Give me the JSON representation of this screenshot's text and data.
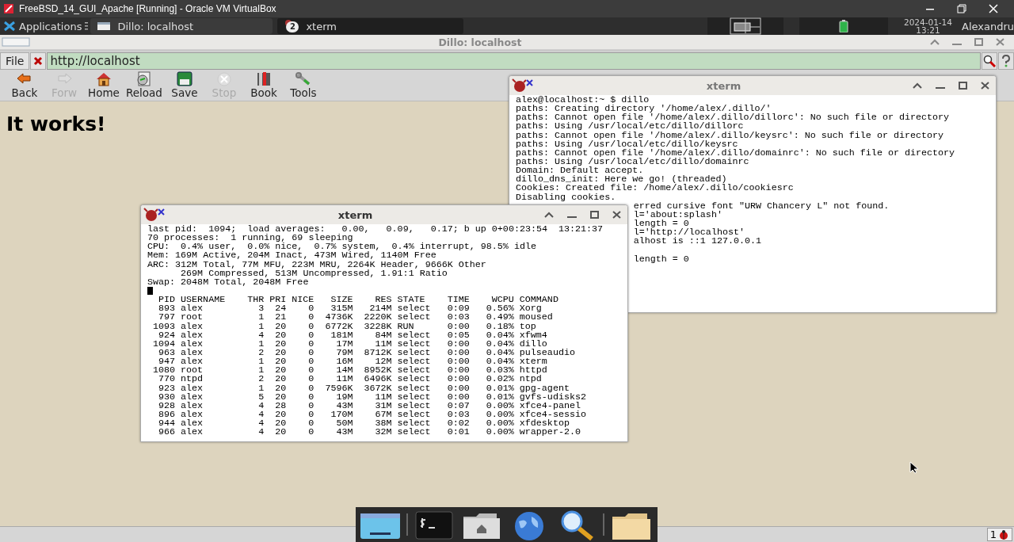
{
  "host_window": {
    "title": "FreeBSD_14_GUI_Apache [Running] - Oracle VM VirtualBox"
  },
  "panel": {
    "menu": "Applications",
    "tasks": [
      {
        "label": "Dillo: localhost",
        "kind": "window"
      },
      {
        "label": "xterm",
        "kind": "group",
        "count": "2"
      }
    ],
    "date": "2024-01-14",
    "time": "13:21",
    "user": "Alexandru"
  },
  "browser": {
    "title": "Dillo: localhost",
    "menu": "File",
    "url": "http://localhost",
    "toolbar": [
      {
        "label": "Back",
        "kind": "back",
        "disabled": false
      },
      {
        "label": "Forw",
        "kind": "forward",
        "disabled": true
      },
      {
        "label": "Home",
        "kind": "home",
        "disabled": false
      },
      {
        "label": "Reload",
        "kind": "reload",
        "disabled": false
      },
      {
        "label": "Save",
        "kind": "save",
        "disabled": false
      },
      {
        "label": "Stop",
        "kind": "stop",
        "disabled": true
      },
      {
        "label": "Book",
        "kind": "book",
        "disabled": false
      },
      {
        "label": "Tools",
        "kind": "tools",
        "disabled": false
      }
    ],
    "heading": "It works!",
    "status": "1"
  },
  "terminals": [
    {
      "title": "xterm",
      "lines": [
        {
          "kind": "full",
          "text": "alex@localhost:~ $ dillo"
        },
        {
          "kind": "full",
          "text": "paths: Creating directory '/home/alex/.dillo/'"
        },
        {
          "kind": "full",
          "text": "paths: Cannot open file '/home/alex/.dillo/dillorc': No such file or directory"
        },
        {
          "kind": "full",
          "text": "paths: Using /usr/local/etc/dillo/dillorc"
        },
        {
          "kind": "full",
          "text": "paths: Cannot open file '/home/alex/.dillo/keysrc': No such file or directory"
        },
        {
          "kind": "full",
          "text": "paths: Using /usr/local/etc/dillo/keysrc"
        },
        {
          "kind": "full",
          "text": "paths: Cannot open file '/home/alex/.dillo/domainrc': No such file or directory"
        },
        {
          "kind": "full",
          "text": "paths: Using /usr/local/etc/dillo/domainrc"
        },
        {
          "kind": "full",
          "text": "Domain: Default accept."
        },
        {
          "kind": "full",
          "text": "dillo_dns_init: Here we go! (threaded)"
        },
        {
          "kind": "full",
          "text": "Cookies: Created file: /home/alex/.dillo/cookiesrc"
        },
        {
          "kind": "full",
          "text": "Disabling cookies."
        },
        {
          "kind": "partial",
          "text": "erred cursive font \"URW Chancery L\" not found."
        },
        {
          "kind": "partial",
          "text": "l='about:splash'"
        },
        {
          "kind": "partial",
          "text": "length = 0"
        },
        {
          "kind": "partial",
          "text": "l='http://localhost'"
        },
        {
          "kind": "partial",
          "text": "alhost is ::1 127.0.0.1"
        },
        {
          "kind": "blank"
        },
        {
          "kind": "partial",
          "text": "length = 0"
        }
      ]
    },
    {
      "title": "xterm",
      "lines": [
        {
          "kind": "full",
          "text": "last pid:  1094;  load averages:   0.00,   0.09,   0.17; b up 0+00:23:54  13:21:37"
        },
        {
          "kind": "full",
          "text": "70 processes:  1 running, 69 sleeping"
        },
        {
          "kind": "full",
          "text": "CPU:  0.4% user,  0.0% nice,  0.7% system,  0.4% interrupt, 98.5% idle"
        },
        {
          "kind": "full",
          "text": "Mem: 169M Active, 204M Inact, 473M Wired, 1140M Free"
        },
        {
          "kind": "full",
          "text": "ARC: 312M Total, 77M MFU, 223M MRU, 2264K Header, 9666K Other"
        },
        {
          "kind": "indented",
          "text": "269M Compressed, 513M Uncompressed, 1.91:1 Ratio"
        },
        {
          "kind": "full",
          "text": "Swap: 2048M Total, 2048M Free"
        },
        {
          "kind": "cursor"
        }
      ],
      "table": {
        "columns": [
          "PID",
          "USERNAME",
          "THR",
          "PRI",
          "NICE",
          "SIZE",
          "RES",
          "STATE",
          "TIME",
          "WCPU",
          "COMMAND"
        ],
        "rows": [
          [
            "893",
            "alex",
            "3",
            "24",
            "0",
            "315M",
            "214M",
            "select",
            "0:09",
            "0.56%",
            "Xorg"
          ],
          [
            "797",
            "root",
            "1",
            "21",
            "0",
            "4736K",
            "2220K",
            "select",
            "0:03",
            "0.49%",
            "moused"
          ],
          [
            "1093",
            "alex",
            "1",
            "20",
            "0",
            "6772K",
            "3228K",
            "RUN",
            "0:00",
            "0.18%",
            "top"
          ],
          [
            "924",
            "alex",
            "4",
            "20",
            "0",
            "181M",
            "84M",
            "select",
            "0:05",
            "0.04%",
            "xfwm4"
          ],
          [
            "1094",
            "alex",
            "1",
            "20",
            "0",
            "17M",
            "11M",
            "select",
            "0:00",
            "0.04%",
            "dillo"
          ],
          [
            "963",
            "alex",
            "2",
            "20",
            "0",
            "79M",
            "8712K",
            "select",
            "0:00",
            "0.04%",
            "pulseaudio"
          ],
          [
            "947",
            "alex",
            "1",
            "20",
            "0",
            "16M",
            "12M",
            "select",
            "0:00",
            "0.04%",
            "xterm"
          ],
          [
            "1080",
            "root",
            "1",
            "20",
            "0",
            "14M",
            "8952K",
            "select",
            "0:00",
            "0.03%",
            "httpd"
          ],
          [
            "770",
            "ntpd",
            "2",
            "20",
            "0",
            "11M",
            "6496K",
            "select",
            "0:00",
            "0.02%",
            "ntpd"
          ],
          [
            "923",
            "alex",
            "1",
            "20",
            "0",
            "7596K",
            "3672K",
            "select",
            "0:00",
            "0.01%",
            "gpg-agent"
          ],
          [
            "930",
            "alex",
            "5",
            "20",
            "0",
            "19M",
            "11M",
            "select",
            "0:00",
            "0.01%",
            "gvfs-udisks2"
          ],
          [
            "928",
            "alex",
            "4",
            "28",
            "0",
            "43M",
            "31M",
            "select",
            "0:07",
            "0.00%",
            "xfce4-panel"
          ],
          [
            "896",
            "alex",
            "4",
            "20",
            "0",
            "170M",
            "67M",
            "select",
            "0:03",
            "0.00%",
            "xfce4-sessio"
          ],
          [
            "944",
            "alex",
            "4",
            "20",
            "0",
            "50M",
            "38M",
            "select",
            "0:02",
            "0.00%",
            "xfdesktop"
          ],
          [
            "966",
            "alex",
            "4",
            "20",
            "0",
            "43M",
            "32M",
            "select",
            "0:01",
            "0.00%",
            "wrapper-2.0"
          ]
        ]
      }
    }
  ]
}
